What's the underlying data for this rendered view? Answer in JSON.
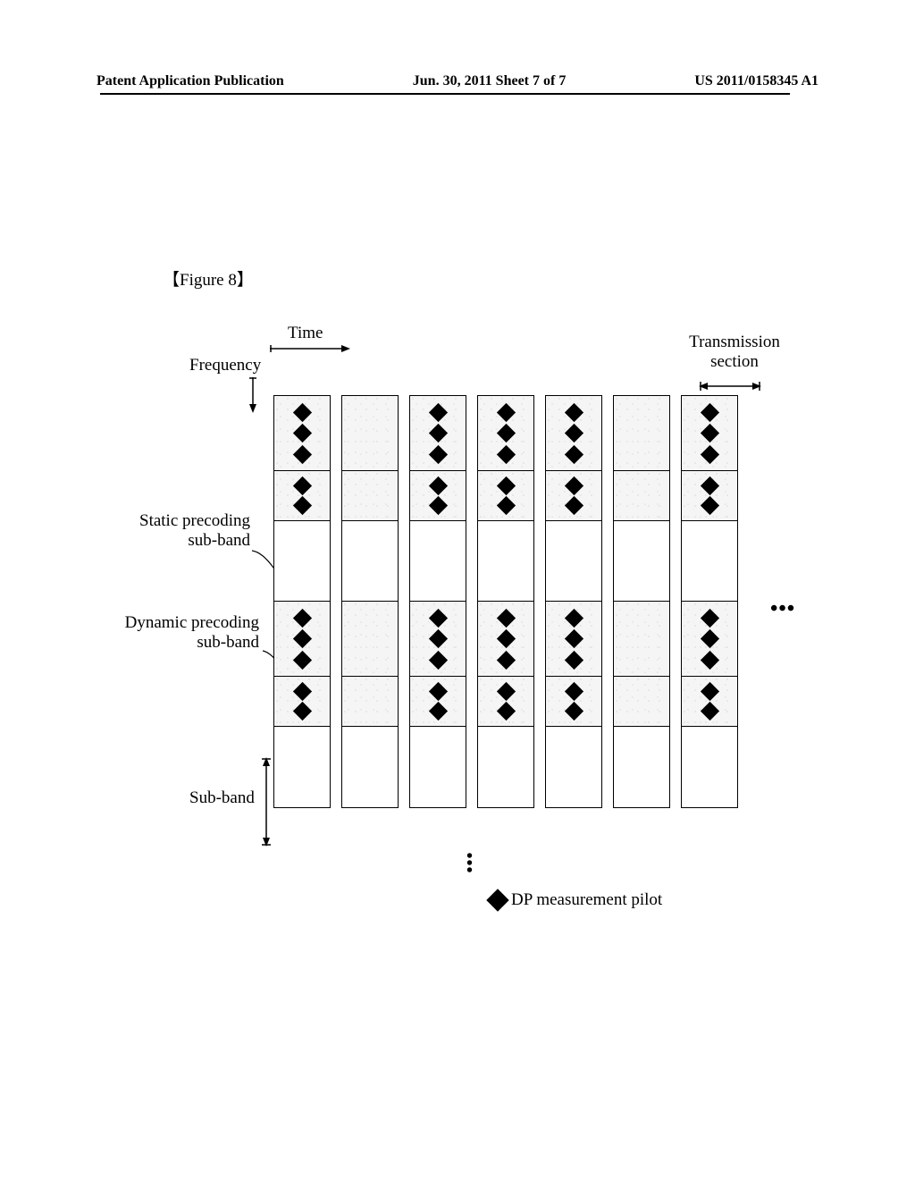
{
  "header": {
    "left": "Patent Application Publication",
    "center": "Jun. 30, 2011  Sheet 7 of 7",
    "right": "US 2011/0158345 A1"
  },
  "figure_label": "【Figure 8】",
  "axis_time": "Time",
  "axis_frequency": "Frequency",
  "transmission_section": "Transmission\nsection",
  "static_precoding": "Static precoding\nsub-band",
  "dynamic_precoding": "Dynamic precoding\nsub-band",
  "sub_band": "Sub-band",
  "legend": "DP measurement pilot",
  "chart_data": {
    "type": "table",
    "title": "Time-frequency grid with DP measurement pilots",
    "x_axis": "Time (transmission sections)",
    "y_axis": "Frequency (sub-bands)",
    "columns_shown": 7,
    "columns_continue": true,
    "rows_per_column": 6,
    "rows_continue": true,
    "row_types": [
      {
        "index": 0,
        "kind": "dynamic-precoding-sub-band",
        "pilots": 3
      },
      {
        "index": 1,
        "kind": "dynamic-precoding-sub-band",
        "pilots": 2
      },
      {
        "index": 2,
        "kind": "static-precoding-sub-band",
        "pilots": 0
      },
      {
        "index": 3,
        "kind": "dynamic-precoding-sub-band",
        "pilots": 3
      },
      {
        "index": 4,
        "kind": "dynamic-precoding-sub-band",
        "pilots": 2
      },
      {
        "index": 5,
        "kind": "static-precoding-sub-band",
        "pilots": 0
      }
    ],
    "pilot_pattern_note": "DP measurement pilots present in columns 1,3,4,5,7 (absent in columns 2 and 6 among shown)",
    "pilot_columns": [
      1,
      3,
      4,
      5,
      7
    ],
    "legend_marker": "filled black diamond"
  }
}
